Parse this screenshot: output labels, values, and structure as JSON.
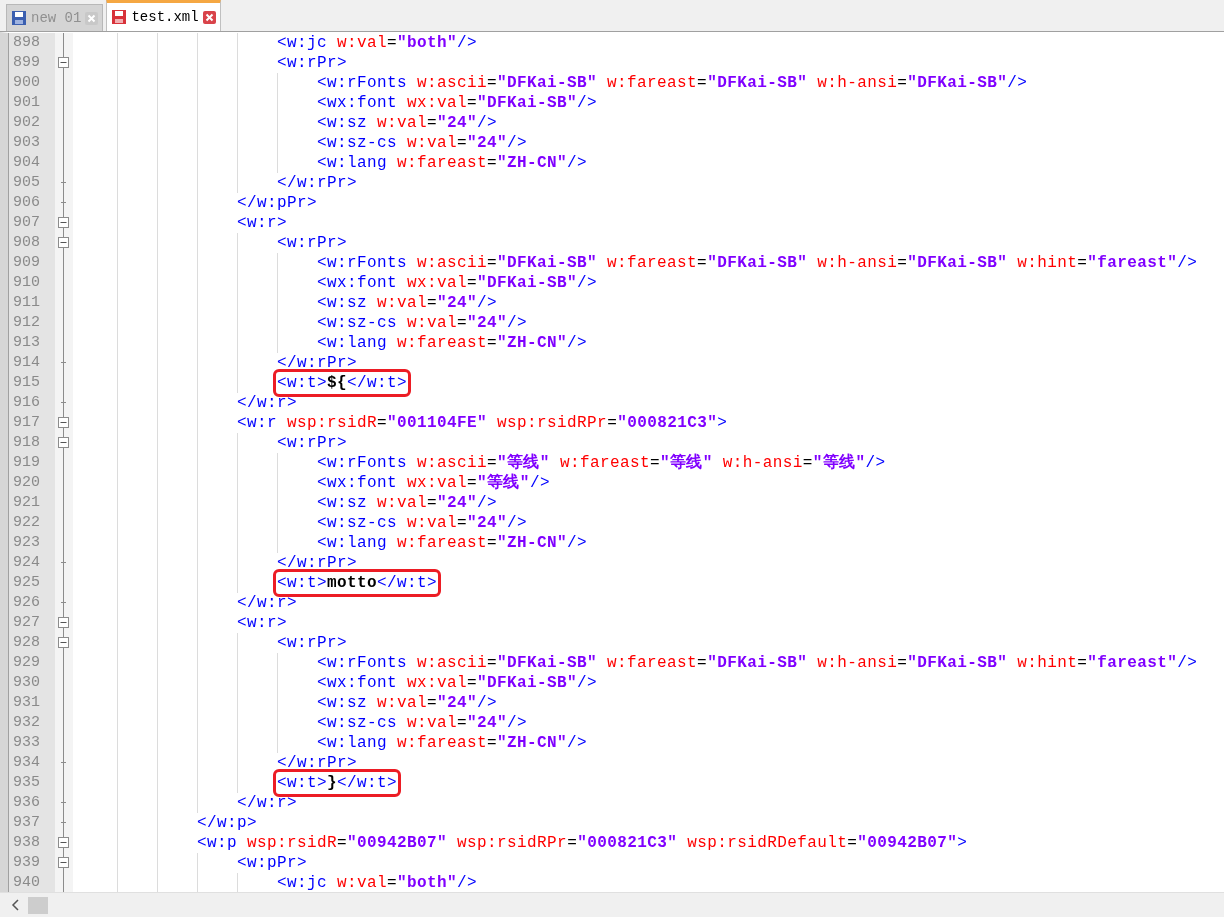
{
  "tabs": [
    {
      "label": "new 01",
      "selected": false,
      "saved": true
    },
    {
      "label": "test.xml",
      "selected": true,
      "saved": false
    }
  ],
  "editor": {
    "lines": [
      {
        "number": "898",
        "kind": "plain",
        "marked": false,
        "text": "                    <w:jc w:val=\"both\"/>"
      },
      {
        "number": "899",
        "kind": "fold-start",
        "marked": false,
        "text": "                    <w:rPr>"
      },
      {
        "number": "900",
        "kind": "plain",
        "marked": false,
        "text": "                        <w:rFonts w:ascii=\"DFKai-SB\" w:fareast=\"DFKai-SB\" w:h-ansi=\"DFKai-SB\"/>"
      },
      {
        "number": "901",
        "kind": "plain",
        "marked": false,
        "text": "                        <wx:font wx:val=\"DFKai-SB\"/>"
      },
      {
        "number": "902",
        "kind": "plain",
        "marked": false,
        "text": "                        <w:sz w:val=\"24\"/>"
      },
      {
        "number": "903",
        "kind": "plain",
        "marked": false,
        "text": "                        <w:sz-cs w:val=\"24\"/>"
      },
      {
        "number": "904",
        "kind": "plain",
        "marked": false,
        "text": "                        <w:lang w:fareast=\"ZH-CN\"/>"
      },
      {
        "number": "905",
        "kind": "fold-end",
        "marked": false,
        "text": "                    </w:rPr>"
      },
      {
        "number": "906",
        "kind": "fold-end",
        "marked": false,
        "text": "                </w:pPr>"
      },
      {
        "number": "907",
        "kind": "fold-start",
        "marked": false,
        "text": "                <w:r>"
      },
      {
        "number": "908",
        "kind": "fold-start",
        "marked": false,
        "text": "                    <w:rPr>"
      },
      {
        "number": "909",
        "kind": "plain",
        "marked": false,
        "text": "                        <w:rFonts w:ascii=\"DFKai-SB\" w:fareast=\"DFKai-SB\" w:h-ansi=\"DFKai-SB\" w:hint=\"fareast\"/>"
      },
      {
        "number": "910",
        "kind": "plain",
        "marked": false,
        "text": "                        <wx:font wx:val=\"DFKai-SB\"/>"
      },
      {
        "number": "911",
        "kind": "plain",
        "marked": false,
        "text": "                        <w:sz w:val=\"24\"/>"
      },
      {
        "number": "912",
        "kind": "plain",
        "marked": false,
        "text": "                        <w:sz-cs w:val=\"24\"/>"
      },
      {
        "number": "913",
        "kind": "plain",
        "marked": false,
        "text": "                        <w:lang w:fareast=\"ZH-CN\"/>"
      },
      {
        "number": "914",
        "kind": "fold-end",
        "marked": false,
        "text": "                    </w:rPr>"
      },
      {
        "number": "915",
        "kind": "plain",
        "marked": true,
        "text": "                    <w:t>${</w:t>"
      },
      {
        "number": "916",
        "kind": "fold-end",
        "marked": false,
        "text": "                </w:r>"
      },
      {
        "number": "917",
        "kind": "fold-start",
        "marked": false,
        "text": "                <w:r wsp:rsidR=\"001104FE\" wsp:rsidRPr=\"000821C3\">"
      },
      {
        "number": "918",
        "kind": "fold-start",
        "marked": false,
        "text": "                    <w:rPr>"
      },
      {
        "number": "919",
        "kind": "plain",
        "marked": false,
        "text": "                        <w:rFonts w:ascii=\"等线\" w:fareast=\"等线\" w:h-ansi=\"等线\"/>"
      },
      {
        "number": "920",
        "kind": "plain",
        "marked": false,
        "text": "                        <wx:font wx:val=\"等线\"/>"
      },
      {
        "number": "921",
        "kind": "plain",
        "marked": false,
        "text": "                        <w:sz w:val=\"24\"/>"
      },
      {
        "number": "922",
        "kind": "plain",
        "marked": false,
        "text": "                        <w:sz-cs w:val=\"24\"/>"
      },
      {
        "number": "923",
        "kind": "plain",
        "marked": false,
        "text": "                        <w:lang w:fareast=\"ZH-CN\"/>"
      },
      {
        "number": "924",
        "kind": "fold-end",
        "marked": false,
        "text": "                    </w:rPr>"
      },
      {
        "number": "925",
        "kind": "plain",
        "marked": true,
        "text": "                    <w:t>motto</w:t>"
      },
      {
        "number": "926",
        "kind": "fold-end",
        "marked": false,
        "text": "                </w:r>"
      },
      {
        "number": "927",
        "kind": "fold-start",
        "marked": false,
        "text": "                <w:r>"
      },
      {
        "number": "928",
        "kind": "fold-start",
        "marked": false,
        "text": "                    <w:rPr>"
      },
      {
        "number": "929",
        "kind": "plain",
        "marked": false,
        "text": "                        <w:rFonts w:ascii=\"DFKai-SB\" w:fareast=\"DFKai-SB\" w:h-ansi=\"DFKai-SB\" w:hint=\"fareast\"/>"
      },
      {
        "number": "930",
        "kind": "plain",
        "marked": false,
        "text": "                        <wx:font wx:val=\"DFKai-SB\"/>"
      },
      {
        "number": "931",
        "kind": "plain",
        "marked": false,
        "text": "                        <w:sz w:val=\"24\"/>"
      },
      {
        "number": "932",
        "kind": "plain",
        "marked": false,
        "text": "                        <w:sz-cs w:val=\"24\"/>"
      },
      {
        "number": "933",
        "kind": "plain",
        "marked": false,
        "text": "                        <w:lang w:fareast=\"ZH-CN\"/>"
      },
      {
        "number": "934",
        "kind": "fold-end",
        "marked": false,
        "text": "                    </w:rPr>"
      },
      {
        "number": "935",
        "kind": "plain",
        "marked": true,
        "text": "                    <w:t>}</w:t>"
      },
      {
        "number": "936",
        "kind": "fold-end",
        "marked": false,
        "text": "                </w:r>"
      },
      {
        "number": "937",
        "kind": "fold-end",
        "marked": false,
        "text": "            </w:p>"
      },
      {
        "number": "938",
        "kind": "fold-start",
        "marked": false,
        "text": "            <w:p wsp:rsidR=\"00942B07\" wsp:rsidRPr=\"000821C3\" wsp:rsidRDefault=\"00942B07\">"
      },
      {
        "number": "939",
        "kind": "fold-start",
        "marked": false,
        "text": "                <w:pPr>"
      },
      {
        "number": "940",
        "kind": "plain",
        "marked": false,
        "text": "                    <w:jc w:val=\"both\"/>"
      }
    ]
  }
}
